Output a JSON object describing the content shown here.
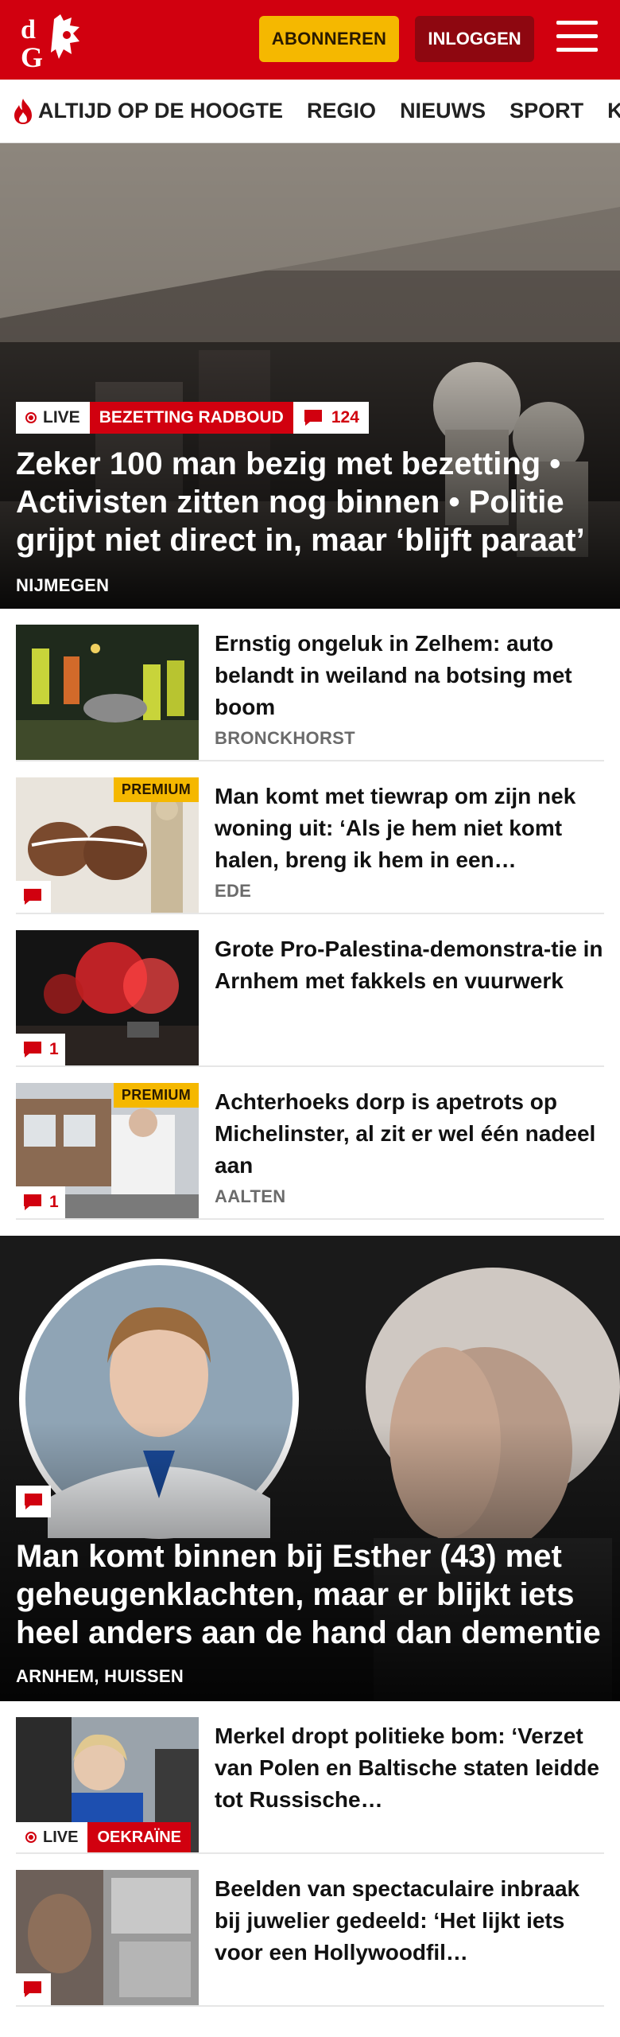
{
  "header": {
    "logo_text": "dG",
    "subscribe_label": "ABONNEREN",
    "login_label": "INLOGGEN"
  },
  "nav": {
    "items": [
      "ALTIJD OP DE HOOGTE",
      "REGIO",
      "NIEUWS",
      "SPORT",
      "KIJK"
    ]
  },
  "hero": {
    "live_label": "LIVE",
    "topic_label": "BEZETTING RADBOUD",
    "comment_count": "124",
    "title": "Zeker 100 man bezig met bezetting • Activisten zitten nog binnen • Politie grijpt niet direct in, maar ‘blijft paraat’",
    "location": "NIJMEGEN"
  },
  "articles": [
    {
      "title": "Ernstig ongeluk in Zelhem: auto belandt in weiland na botsing met boom",
      "location": "BRONCKHORST"
    },
    {
      "title": "Man komt met tiewrap om zijn nek woning uit: ‘Als je hem niet komt halen, breng ik hem in een…",
      "location": "EDE",
      "premium": "PREMIUM"
    },
    {
      "title": "Grote Pro-Palestina-demonstra-tie in Arnhem met fakkels en vuurwerk",
      "comments": "1"
    },
    {
      "title": "Achterhoeks dorp is apetrots op Michelinster, al zit er wel één nadeel aan",
      "location": "AALTEN",
      "premium": "PREMIUM",
      "comments": "1"
    }
  ],
  "feature": {
    "title": "Man komt binnen bij Esther (43) met geheugenklachten, maar er blijkt iets heel anders aan de hand dan dementie",
    "location": "ARNHEM, HUISSEN"
  },
  "more_articles": [
    {
      "title": "Merkel dropt politieke bom: ‘Verzet van Polen en Baltische staten leidde tot Russische…",
      "live_label": "LIVE",
      "topic_label": "OEKRAÏNE"
    },
    {
      "title": "Beelden van spectaculaire inbraak bij juwelier gedeeld: ‘Het lijkt iets voor een Hollywoodfil…"
    }
  ],
  "colors": {
    "brand_red": "#d1000f",
    "accent_yellow": "#f5b800",
    "login_dark_red": "#8e0710"
  },
  "icons": [
    "menu-icon",
    "flame-icon",
    "live-dot-icon",
    "comment-icon"
  ]
}
